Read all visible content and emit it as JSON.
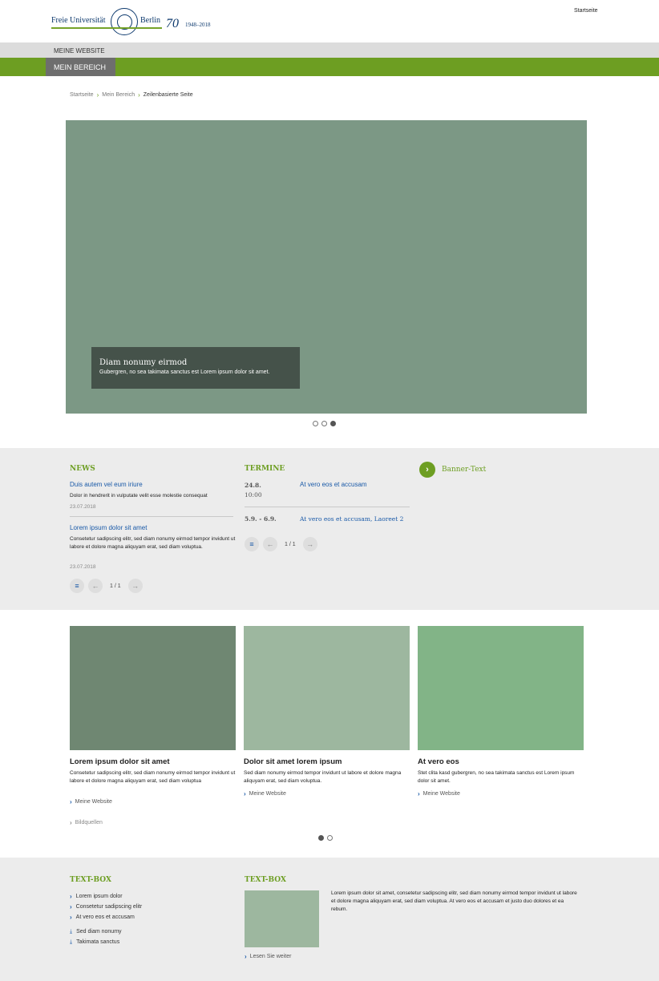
{
  "header": {
    "logo_left": "Freie Universität",
    "logo_right": "Berlin",
    "logo_seventy": "70",
    "logo_years": "1948–2018",
    "top_link": "Startseite"
  },
  "nav": {
    "site_label": "Meine Website",
    "section_tab": "Mein Bereich"
  },
  "breadcrumb": {
    "items": [
      "Startseite",
      "Mein Bereich"
    ],
    "current": "Zeilenbasierte Seite"
  },
  "hero": {
    "title": "Diam nonumy eirmod",
    "subtitle": "Gubergren, no sea takimata sanctus est Lorem ipsum dolor sit amet."
  },
  "news": {
    "title": "News",
    "items": [
      {
        "title": "Duis autem vel eum iriure",
        "text": "Dolor in hendrerit in vulputate velit esse molestie consequat",
        "date": "23.07.2018"
      },
      {
        "title": "Lorem ipsum dolor sit amet",
        "text": "Consetetur sadipscing elitr, sed diam nonumy eirmod tempor invidunt ut labore et dolore magna aliquyam erat, sed diam voluptua.",
        "date": "23.07.2018"
      }
    ],
    "pager": "1 / 1"
  },
  "termine": {
    "title": "Termine",
    "items": [
      {
        "date": "24.8.",
        "time": "10:00",
        "title": "At vero eos et accusam"
      },
      {
        "date": "5.9. - 6.9.",
        "time": "",
        "title": "At vero eos et accusam, Laoreet 2"
      }
    ],
    "pager": "1 / 1"
  },
  "banner": {
    "text": "Banner-Text"
  },
  "cards": [
    {
      "title": "Lorem ipsum dolor sit amet",
      "text": "Consetetur sadipscing elitr, sed diam nonumy eirmod tempor invidunt ut labore et dolore magna aliquyam erat, sed diam voluptua",
      "link": "Meine Website",
      "color": "#6f8772"
    },
    {
      "title": "Dolor sit amet lorem ipsum",
      "text": "Sed diam nonumy eirmod tempor invidunt ut labore et dolore magna aliquyam erat, sed diam voluptua.",
      "link": "Meine Website",
      "color": "#9db79f"
    },
    {
      "title": "At vero eos",
      "text": "Stet clita kasd gubergren, no sea takimata sanctus est Lorem ipsum dolor sit amet.",
      "link": "Meine Website",
      "color": "#82b487"
    }
  ],
  "cards_extra_link": "Bildquellen",
  "footer": {
    "box1": {
      "title": "Text-Box",
      "links": [
        "Lorem ipsum dolor",
        "Consetetur sadipscing elitr",
        "At vero eos et accusam"
      ],
      "downloads": [
        "Sed diam nonumy",
        "Takimata sanctus"
      ]
    },
    "box2": {
      "title": "Text-Box",
      "text": "Lorem ipsum dolor sit amet, consetetur sadipscing elitr, sed diam nonumy eirmod tempor invidunt ut labore et dolore magna aliquyam erat, sed diam voluptua. At vero eos et accusam et justo duo dolores et ea rebum.",
      "link": "Lesen Sie weiter",
      "image_color": "#9db79f"
    }
  },
  "colors": {
    "brand_green": "#6d9e22",
    "link_blue": "#1a5aa8",
    "hero": "#7c9885"
  }
}
